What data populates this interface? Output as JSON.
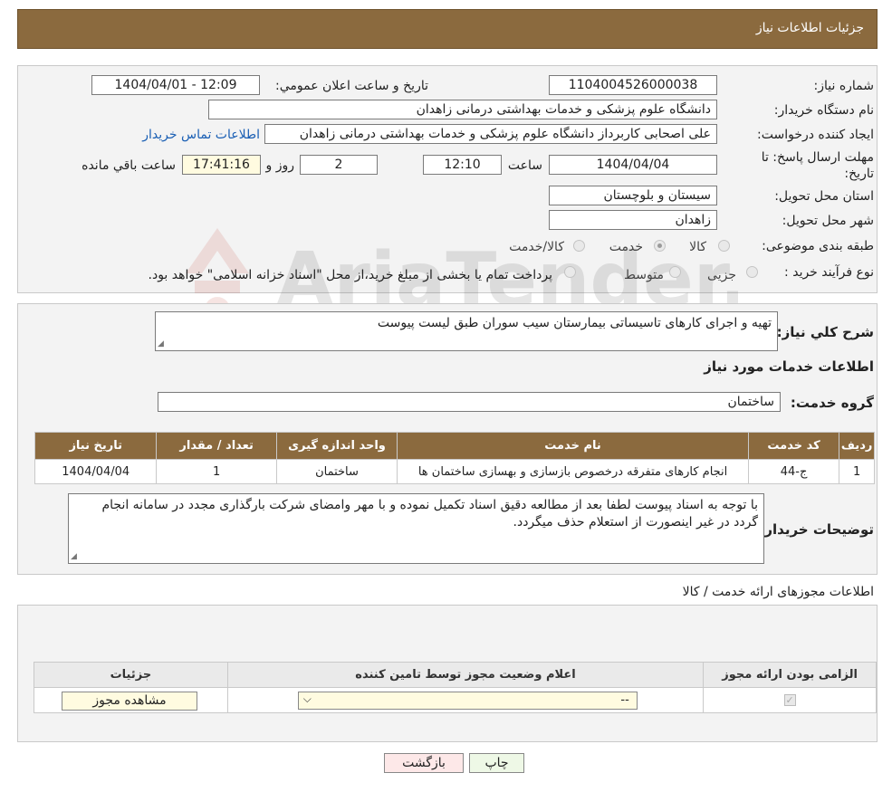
{
  "header": {
    "title": "جزئیات اطلاعات نیاز"
  },
  "fields": {
    "need_number_label": "شماره نیاز:",
    "need_number": "1104004526000038",
    "announce_label": "تاریخ و ساعت اعلان عمومي:",
    "announce_value": "1404/04/01 - 12:09",
    "buyer_org_label": "نام دستگاه خریدار:",
    "buyer_org": "دانشگاه علوم پزشکی و خدمات بهداشتی درمانی زاهدان",
    "creator_label": "ایجاد کننده درخواست:",
    "creator": "علی اصحابی کاربرداز دانشگاه علوم پزشکی و خدمات بهداشتی درمانی زاهدان",
    "contact_link": "اطلاعات تماس خریدار",
    "deadline_label_1": "مهلت ارسال پاسخ: تا",
    "deadline_label_2": "تاریخ:",
    "deadline_date": "1404/04/04",
    "time_label": "ساعت",
    "deadline_time": "12:10",
    "days_value": "2",
    "days_label": "روز و",
    "remaining_time": "17:41:16",
    "remaining_label": "ساعت باقي مانده",
    "province_label": "استان محل تحویل:",
    "province": "سیستان و بلوچستان",
    "city_label": "شهر محل تحویل:",
    "city": "زاهدان",
    "category_label": "طبقه بندی موضوعی:",
    "category_options": [
      "کالا",
      "خدمت",
      "کالا/خدمت"
    ],
    "category_selected": "خدمت",
    "process_label": "نوع فرآیند خرید :",
    "process_options": [
      "جزیی",
      "متوسط"
    ],
    "process_note": "پرداخت تمام یا بخشی از مبلغ خرید،از محل \"اسناد خزانه اسلامی\" خواهد بود."
  },
  "summary": {
    "label": "شرح کلي نیاز:",
    "text": "تهیه و اجرای کارهای تاسیساتی بیمارستان سیب سوران طبق لیست پیوست"
  },
  "services": {
    "section_title": "اطلاعات خدمات مورد نیاز",
    "group_label": "گروه خدمت:",
    "group_value": "ساختمان",
    "columns": [
      "ردیف",
      "کد خدمت",
      "نام خدمت",
      "واحد اندازه گیری",
      "تعداد / مقدار",
      "تاریخ نیاز"
    ],
    "rows": [
      [
        "1",
        "ج-44",
        "انجام کارهای متفرقه درخصوص بازسازی و بهسازی ساختمان ها",
        "ساختمان",
        "1",
        "1404/04/04"
      ]
    ]
  },
  "buyer_notes": {
    "label": "توضیحات خریدار:",
    "text": "با توجه به اسناد پیوست لطفا بعد از مطالعه دقیق اسناد تکمیل نموده و با مهر وامضای شرکت بارگذاری مجدد در سامانه انجام گردد در غیر اینصورت از استعلام حذف میگردد."
  },
  "permits": {
    "section_title": "اطلاعات مجوزهای ارائه خدمت / کالا",
    "columns": [
      "الزامی بودن ارائه مجوز",
      "اعلام وضعیت مجوز توسط تامین کننده",
      "جزئیات"
    ],
    "select_value": "--",
    "view_button": "مشاهده مجوز"
  },
  "buttons": {
    "print": "چاپ",
    "back": "بازگشت"
  },
  "watermark": "AriaTender.neT",
  "colors": {
    "header": "#8b6a3e",
    "link": "#1a5fb4",
    "back_button": "#fde8e8",
    "print_button": "#eef8e6"
  }
}
